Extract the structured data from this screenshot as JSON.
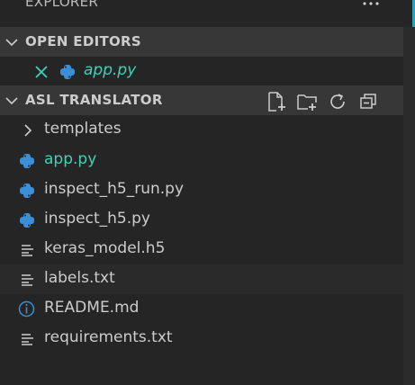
{
  "explorer": {
    "title": "EXPLORER"
  },
  "open_editors": {
    "header": "OPEN EDITORS",
    "files": [
      {
        "name": "app.py",
        "icon": "python-icon"
      }
    ]
  },
  "project": {
    "header": "ASL TRANSLATOR",
    "actions": [
      "new-file-icon",
      "new-folder-icon",
      "refresh-icon",
      "collapse-all-icon"
    ],
    "items": [
      {
        "name": "templates",
        "type": "folder",
        "icon": "chevron-right-icon"
      },
      {
        "name": "app.py",
        "type": "file",
        "icon": "python-icon",
        "active": true
      },
      {
        "name": "inspect_h5_run.py",
        "type": "file",
        "icon": "python-icon"
      },
      {
        "name": "inspect_h5.py",
        "type": "file",
        "icon": "python-icon"
      },
      {
        "name": "keras_model.h5",
        "type": "file",
        "icon": "lines-icon"
      },
      {
        "name": "labels.txt",
        "type": "file",
        "icon": "lines-icon"
      },
      {
        "name": "README.md",
        "type": "file",
        "icon": "info-icon"
      },
      {
        "name": "requirements.txt",
        "type": "file",
        "icon": "lines-icon"
      }
    ]
  },
  "colors": {
    "background": "#252526",
    "header_bg": "#373737",
    "active_file": "#3dd3b8",
    "python_icon": "#3b8fd6",
    "info_icon": "#3b8fd6",
    "close_icon": "#3dd3b8",
    "text": "#cccccc"
  }
}
